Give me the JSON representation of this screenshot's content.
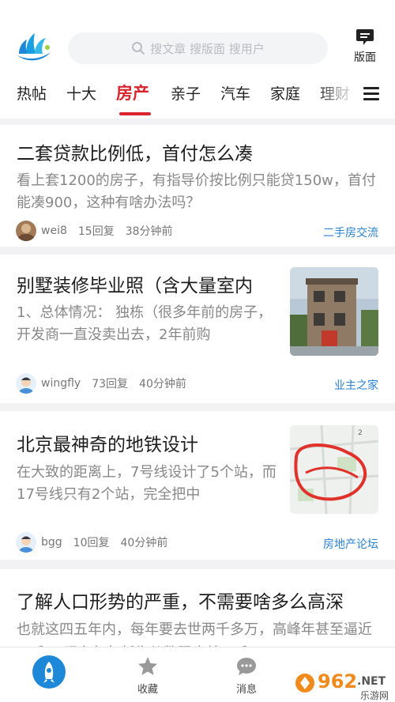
{
  "search": {
    "placeholder": "搜文章 搜版面 搜用户"
  },
  "header": {
    "board_label": "版面"
  },
  "tabs": [
    {
      "label": "热帖"
    },
    {
      "label": "十大"
    },
    {
      "label": "房产"
    },
    {
      "label": "亲子"
    },
    {
      "label": "汽车"
    },
    {
      "label": "家庭"
    },
    {
      "label": "理财"
    }
  ],
  "active_tab": "房产",
  "posts": [
    {
      "title": "二套贷款比例低，首付怎么凑",
      "summary": "看上套1200的房子，有指导价按比例只能贷150w，首付能凑900，这种有啥办法吗？",
      "user": "wei8",
      "replies": "15回复",
      "time": "38分钟前",
      "board": "二手房交流"
    },
    {
      "title": "别墅装修毕业照（含大量室内",
      "summary": "1、总体情况： 独栋（很多年前的房子，开发商一直没卖出去，2年前购",
      "user": "wingfly",
      "replies": "73回复",
      "time": "40分钟前",
      "board": "业主之家"
    },
    {
      "title": "北京最神奇的地铁设计",
      "summary": "在大致的距离上，7号线设计了5个站，而17号线只有2个站，完全把中",
      "user": "bgg",
      "replies": "10回复",
      "time": "40分钟前",
      "board": "房地产论坛"
    },
    {
      "title": "了解人口形势的严重，不需要啥多么高深",
      "summary": "也就这四五年内，每年要去世两千多万，高峰年甚至逼近三千万 现在每年新生儿数跟也就一千万"
    }
  ],
  "bottom_nav": [
    {
      "label": ""
    },
    {
      "label": "收藏"
    },
    {
      "label": "消息"
    }
  ],
  "watermark": {
    "text": "962.NET",
    "sub": "乐游网"
  },
  "colors": {
    "accent": "#d8242c",
    "link": "#2a82d2",
    "nav_active": "#1e88d8"
  }
}
